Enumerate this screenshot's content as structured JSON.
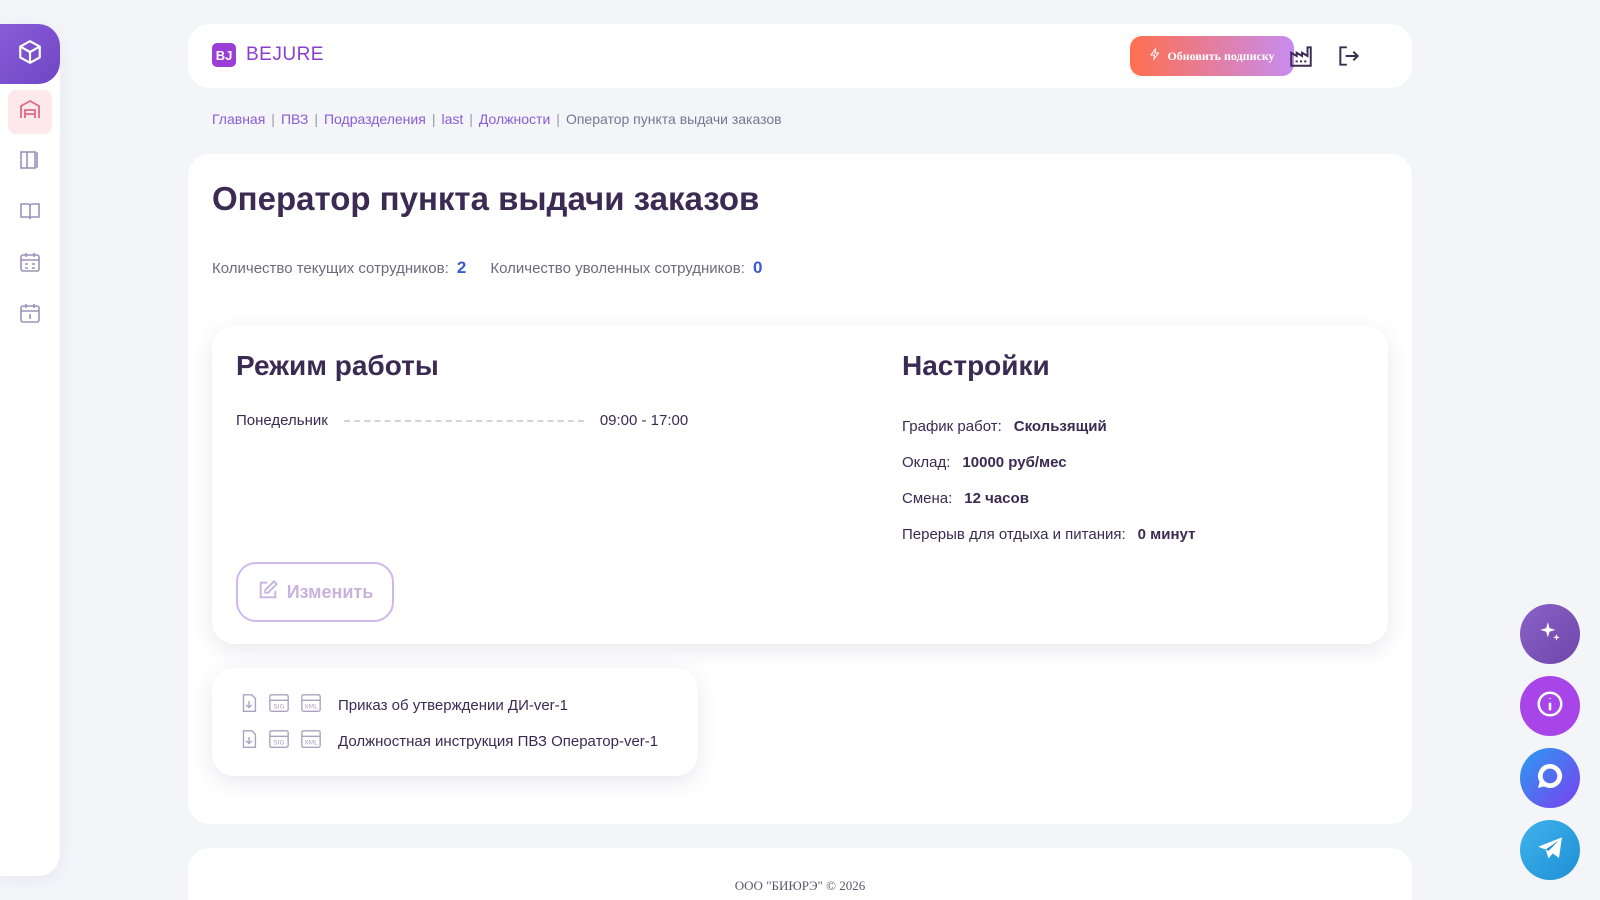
{
  "sidebar": {
    "logo_icon": "box-icon",
    "items": [
      {
        "icon": "warehouse-icon",
        "active": true
      },
      {
        "icon": "board-icon",
        "active": false
      },
      {
        "icon": "book-icon",
        "active": false
      },
      {
        "icon": "calendar-grid-icon",
        "active": false
      },
      {
        "icon": "calendar-day-icon",
        "active": false
      }
    ]
  },
  "header": {
    "brand_mark": "BJ",
    "brand_name": "BEJURE",
    "upgrade_label": "Обновить подписку",
    "icons": [
      "factory-icon",
      "logout-icon"
    ]
  },
  "breadcrumb": {
    "items": [
      "Главная",
      "ПВЗ",
      "Подразделения",
      "last",
      "Должности"
    ],
    "current": "Оператор пункта выдачи заказов",
    "separator": "|"
  },
  "page": {
    "title": "Оператор пункта выдачи заказов",
    "current_employees_label": "Количество текущих сотрудников:",
    "current_employees": "2",
    "fired_employees_label": "Количество уволенных сотрудников:",
    "fired_employees": "0"
  },
  "schedule": {
    "title": "Режим работы",
    "rows": [
      {
        "day": "Понедельник",
        "hours": "09:00 - 17:00"
      }
    ],
    "edit_label": "Изменить"
  },
  "settings": {
    "title": "Настройки",
    "rows": [
      {
        "label": "График работ:",
        "value": "Скользящий"
      },
      {
        "label": "Оклад:",
        "value": "10000 руб/мес"
      },
      {
        "label": "Смена:",
        "value": "12 часов"
      },
      {
        "label": "Перерыв для отдыха и питания:",
        "value": "0 минут"
      }
    ]
  },
  "documents": [
    {
      "name": "Приказ об утверждении ДИ-ver-1",
      "icons": [
        "download-icon",
        "sig-file-icon",
        "xml-file-icon"
      ]
    },
    {
      "name": "Должностная инструкция ПВЗ Оператор-ver-1",
      "icons": [
        "download-icon",
        "sig-file-icon",
        "xml-file-icon"
      ]
    }
  ],
  "footer": {
    "text": "ООО \"БИЮРЭ\" © 2026"
  },
  "fabs": [
    "sparkles-icon",
    "info-icon",
    "chat-icon",
    "telegram-icon"
  ],
  "colors": {
    "accent": "#8a5cd8",
    "brand": "#9b3ed6",
    "number": "#3a5ad0",
    "title": "#3b2a52"
  }
}
